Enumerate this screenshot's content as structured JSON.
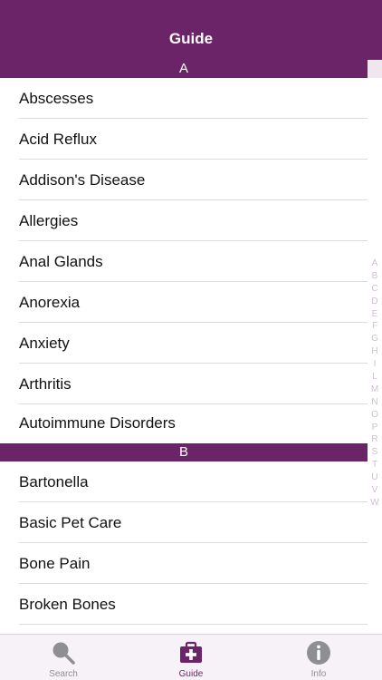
{
  "nav": {
    "title": "Guide"
  },
  "sections": [
    {
      "letter": "A",
      "items": [
        "Abscesses",
        "Acid Reflux",
        "Addison's Disease",
        "Allergies",
        "Anal Glands",
        "Anorexia",
        "Anxiety",
        "Arthritis",
        "Autoimmune Disorders"
      ]
    },
    {
      "letter": "B",
      "items": [
        "Bartonella",
        "Basic Pet Care",
        "Bone Pain",
        "Broken Bones"
      ]
    }
  ],
  "index": [
    "A",
    "B",
    "C",
    "D",
    "E",
    "F",
    "G",
    "H",
    "I",
    "L",
    "M",
    "N",
    "O",
    "P",
    "R",
    "S",
    "T",
    "U",
    "V",
    "W"
  ],
  "tabs": [
    {
      "label": "Search",
      "icon": "search-icon",
      "active": false
    },
    {
      "label": "Guide",
      "icon": "medical-kit-icon",
      "active": true
    },
    {
      "label": "Info",
      "icon": "info-icon",
      "active": false
    }
  ],
  "colors": {
    "brand": "#6b2468",
    "tab_inactive": "#8e8e93",
    "index_text": "#cfbfd3"
  }
}
